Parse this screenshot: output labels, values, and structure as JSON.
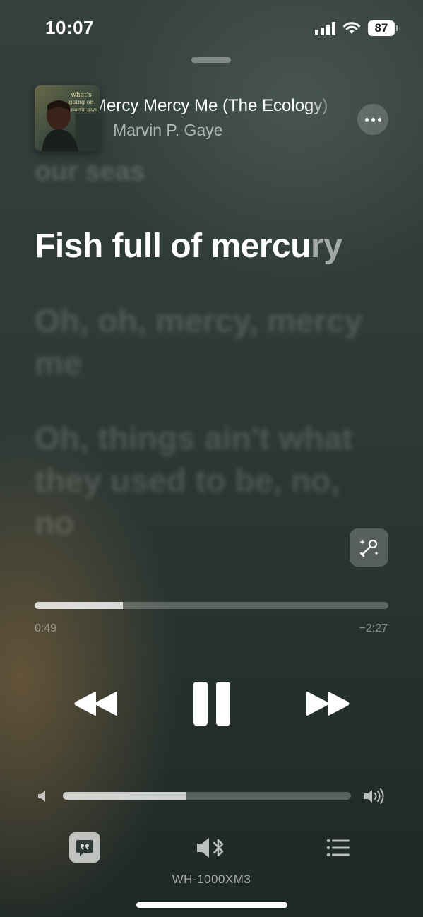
{
  "status_bar": {
    "time": "10:07",
    "battery": "87"
  },
  "now_playing": {
    "title": "Mercy Mercy Me (The Ecology)",
    "artist": "Marvin P. Gaye",
    "artwork_text": [
      "what's",
      "going on",
      "marvin gaye"
    ]
  },
  "lyrics": {
    "previous": "our seas",
    "current_sung": "Fish full of mercu",
    "current_rest": "ry",
    "next": [
      "Oh, oh, mercy, mercy me",
      "Oh, things ain't what they used to be, no, no"
    ]
  },
  "playback": {
    "elapsed": "0:49",
    "remaining": "−2:27",
    "progress": 0.25,
    "volume": 0.43
  },
  "output": {
    "device": "WH-1000XM3"
  },
  "icons": {
    "more": "ellipsis-icon",
    "sing": "microphone-sparkle-icon",
    "rewind": "backward-icon",
    "pause": "pause-icon",
    "forward": "forward-icon",
    "lyrics": "quote-bubble-icon",
    "airplay": "speaker-bluetooth-icon",
    "queue": "list-icon"
  }
}
